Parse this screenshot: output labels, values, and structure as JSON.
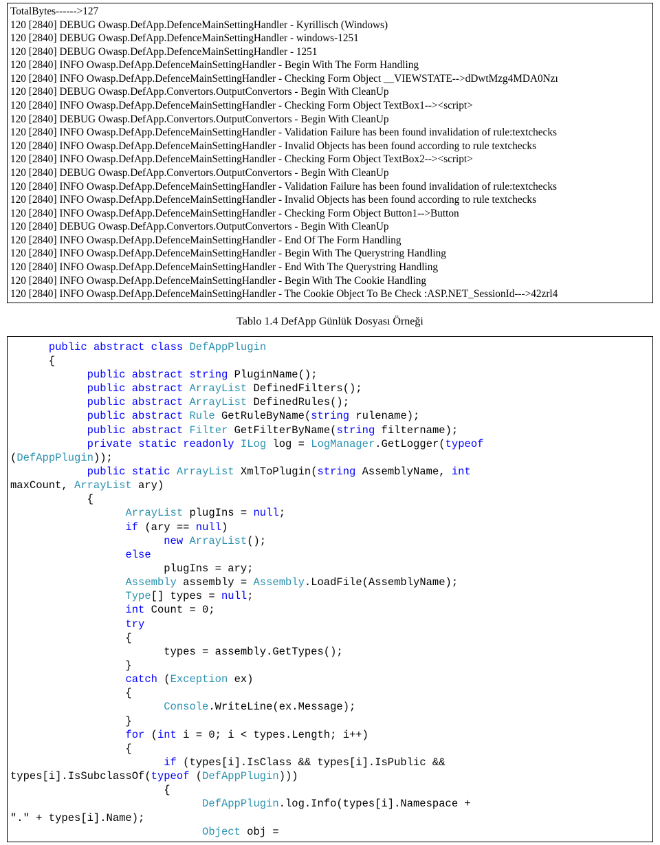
{
  "log": {
    "lines": [
      "TotalBytes------>127",
      "120 [2840] DEBUG Owasp.DefApp.DefenceMainSettingHandler - Kyrillisch (Windows)",
      "120 [2840] DEBUG Owasp.DefApp.DefenceMainSettingHandler - windows-1251",
      "120 [2840] DEBUG Owasp.DefApp.DefenceMainSettingHandler - 1251",
      "120 [2840] INFO  Owasp.DefApp.DefenceMainSettingHandler - Begin With The Form Handling",
      "120 [2840] INFO  Owasp.DefApp.DefenceMainSettingHandler - Checking Form Object __VIEWSTATE-->dDwtMzg4MDA0Nzı",
      "120 [2840] DEBUG Owasp.DefApp.Convertors.OutputConvertors - Begin With CleanUp",
      "120 [2840] INFO  Owasp.DefApp.DefenceMainSettingHandler - Checking Form Object TextBox1--><script>",
      "120 [2840] DEBUG Owasp.DefApp.Convertors.OutputConvertors - Begin With CleanUp",
      "120 [2840] INFO  Owasp.DefApp.DefenceMainSettingHandler - Validation Failure has been found invalidation of rule:textchecks",
      "120 [2840] INFO  Owasp.DefApp.DefenceMainSettingHandler - Invalid Objects has been found according to rule textchecks",
      "120 [2840] INFO  Owasp.DefApp.DefenceMainSettingHandler - Checking Form Object TextBox2--><script>",
      "120 [2840] DEBUG Owasp.DefApp.Convertors.OutputConvertors - Begin With CleanUp",
      "120 [2840] INFO  Owasp.DefApp.DefenceMainSettingHandler - Validation Failure has been found invalidation of rule:textchecks",
      "120 [2840] INFO  Owasp.DefApp.DefenceMainSettingHandler - Invalid Objects has been found according to rule textchecks",
      "120 [2840] INFO  Owasp.DefApp.DefenceMainSettingHandler - Checking Form Object Button1-->Button",
      "120 [2840] DEBUG Owasp.DefApp.Convertors.OutputConvertors - Begin With CleanUp",
      "120 [2840] INFO  Owasp.DefApp.DefenceMainSettingHandler - End Of The Form Handling",
      "120 [2840] INFO  Owasp.DefApp.DefenceMainSettingHandler - Begin With The Querystring Handling",
      "120 [2840] INFO  Owasp.DefApp.DefenceMainSettingHandler - End With The Querystring Handling",
      "120 [2840] INFO  Owasp.DefApp.DefenceMainSettingHandler - Begin With The Cookie Handling",
      "120 [2840] INFO  Owasp.DefApp.DefenceMainSettingHandler - The Cookie Object To Be Check :ASP.NET_SessionId--->42zrl4"
    ]
  },
  "caption": "Tablo 1.4 DefApp Günlük Dosyası Örneği",
  "code": {
    "tokens": [
      [
        [
          "      "
        ],
        [
          "kw",
          "public"
        ],
        [
          " "
        ],
        [
          "kw",
          "abstract"
        ],
        [
          " "
        ],
        [
          "kw",
          "class"
        ],
        [
          " "
        ],
        [
          "typ",
          "DefAppPlugin"
        ]
      ],
      [
        [
          "      {"
        ]
      ],
      [
        [
          "            "
        ],
        [
          "kw",
          "public"
        ],
        [
          " "
        ],
        [
          "kw",
          "abstract"
        ],
        [
          " "
        ],
        [
          "kw",
          "string"
        ],
        [
          " PluginName();"
        ]
      ],
      [
        [
          "            "
        ],
        [
          "kw",
          "public"
        ],
        [
          " "
        ],
        [
          "kw",
          "abstract"
        ],
        [
          " "
        ],
        [
          "typ",
          "ArrayList"
        ],
        [
          " DefinedFilters();"
        ]
      ],
      [
        [
          "            "
        ],
        [
          "kw",
          "public"
        ],
        [
          " "
        ],
        [
          "kw",
          "abstract"
        ],
        [
          " "
        ],
        [
          "typ",
          "ArrayList"
        ],
        [
          " DefinedRules();"
        ]
      ],
      [
        [
          "            "
        ],
        [
          "kw",
          "public"
        ],
        [
          " "
        ],
        [
          "kw",
          "abstract"
        ],
        [
          " "
        ],
        [
          "typ",
          "Rule"
        ],
        [
          " GetRuleByName("
        ],
        [
          "kw",
          "string"
        ],
        [
          " rulename);"
        ]
      ],
      [
        [
          "            "
        ],
        [
          "kw",
          "public"
        ],
        [
          " "
        ],
        [
          "kw",
          "abstract"
        ],
        [
          " "
        ],
        [
          "typ",
          "Filter"
        ],
        [
          " GetFilterByName("
        ],
        [
          "kw",
          "string"
        ],
        [
          " filtername);"
        ]
      ],
      [
        [
          "            "
        ],
        [
          "kw",
          "private"
        ],
        [
          " "
        ],
        [
          "kw",
          "static"
        ],
        [
          " "
        ],
        [
          "kw",
          "readonly"
        ],
        [
          " "
        ],
        [
          "typ",
          "ILog"
        ],
        [
          " log = "
        ],
        [
          "typ",
          "LogManager"
        ],
        [
          ".GetLogger("
        ],
        [
          "kw",
          "typeof"
        ]
      ],
      [
        [
          "("
        ],
        [
          "typ",
          "DefAppPlugin"
        ],
        [
          "));"
        ]
      ],
      [
        [
          "            "
        ],
        [
          "kw",
          "public"
        ],
        [
          " "
        ],
        [
          "kw",
          "static"
        ],
        [
          " "
        ],
        [
          "typ",
          "ArrayList"
        ],
        [
          " XmlToPlugin("
        ],
        [
          "kw",
          "string"
        ],
        [
          " AssemblyName, "
        ],
        [
          "kw",
          "int"
        ]
      ],
      [
        [
          "maxCount, "
        ],
        [
          "typ",
          "ArrayList"
        ],
        [
          " ary)"
        ]
      ],
      [
        [
          "            {"
        ]
      ],
      [
        [
          "                  "
        ],
        [
          "typ",
          "ArrayList"
        ],
        [
          " plugIns = "
        ],
        [
          "kw",
          "null"
        ],
        [
          ";"
        ]
      ],
      [
        [
          "                  "
        ],
        [
          "kw",
          "if"
        ],
        [
          " (ary == "
        ],
        [
          "kw",
          "null"
        ],
        [
          ")"
        ]
      ],
      [
        [
          "                        "
        ],
        [
          "kw",
          "new"
        ],
        [
          " "
        ],
        [
          "typ",
          "ArrayList"
        ],
        [
          "();"
        ]
      ],
      [
        [
          "                  "
        ],
        [
          "kw",
          "else"
        ]
      ],
      [
        [
          "                        plugIns = ary;"
        ]
      ],
      [
        [
          "                  "
        ],
        [
          "typ",
          "Assembly"
        ],
        [
          " assembly = "
        ],
        [
          "typ",
          "Assembly"
        ],
        [
          ".LoadFile(AssemblyName);"
        ]
      ],
      [
        [
          "                  "
        ],
        [
          "typ",
          "Type"
        ],
        [
          "[] types = "
        ],
        [
          "kw",
          "null"
        ],
        [
          ";"
        ]
      ],
      [
        [
          "                  "
        ],
        [
          "kw",
          "int"
        ],
        [
          " Count = 0;"
        ]
      ],
      [
        [
          "                  "
        ],
        [
          "kw",
          "try"
        ]
      ],
      [
        [
          "                  {"
        ]
      ],
      [
        [
          "                        types = assembly.GetTypes();"
        ]
      ],
      [
        [
          "                  }"
        ]
      ],
      [
        [
          "                  "
        ],
        [
          "kw",
          "catch"
        ],
        [
          " ("
        ],
        [
          "typ",
          "Exception"
        ],
        [
          " ex)"
        ]
      ],
      [
        [
          "                  {"
        ]
      ],
      [
        [
          "                        "
        ],
        [
          "typ",
          "Console"
        ],
        [
          ".WriteLine(ex.Message);"
        ]
      ],
      [
        [
          "                  }"
        ]
      ],
      [
        [
          "                  "
        ],
        [
          "kw",
          "for"
        ],
        [
          " ("
        ],
        [
          "kw",
          "int"
        ],
        [
          " i = 0; i < types.Length; i++)"
        ]
      ],
      [
        [
          "                  {"
        ]
      ],
      [
        [
          "                        "
        ],
        [
          "kw",
          "if"
        ],
        [
          " (types[i].IsClass && types[i].IsPublic &&"
        ]
      ],
      [
        [
          "types[i].IsSubclassOf("
        ],
        [
          "kw",
          "typeof"
        ],
        [
          " ("
        ],
        [
          "typ",
          "DefAppPlugin"
        ],
        [
          ")))"
        ]
      ],
      [
        [
          "                        {"
        ]
      ],
      [
        [
          "                              "
        ],
        [
          "typ",
          "DefAppPlugin"
        ],
        [
          ".log.Info(types[i].Namespace +"
        ]
      ],
      [
        [
          "\".\" + types[i].Name);"
        ]
      ],
      [
        [
          "                              "
        ],
        [
          "typ",
          "Object"
        ],
        [
          " obj ="
        ]
      ]
    ]
  }
}
